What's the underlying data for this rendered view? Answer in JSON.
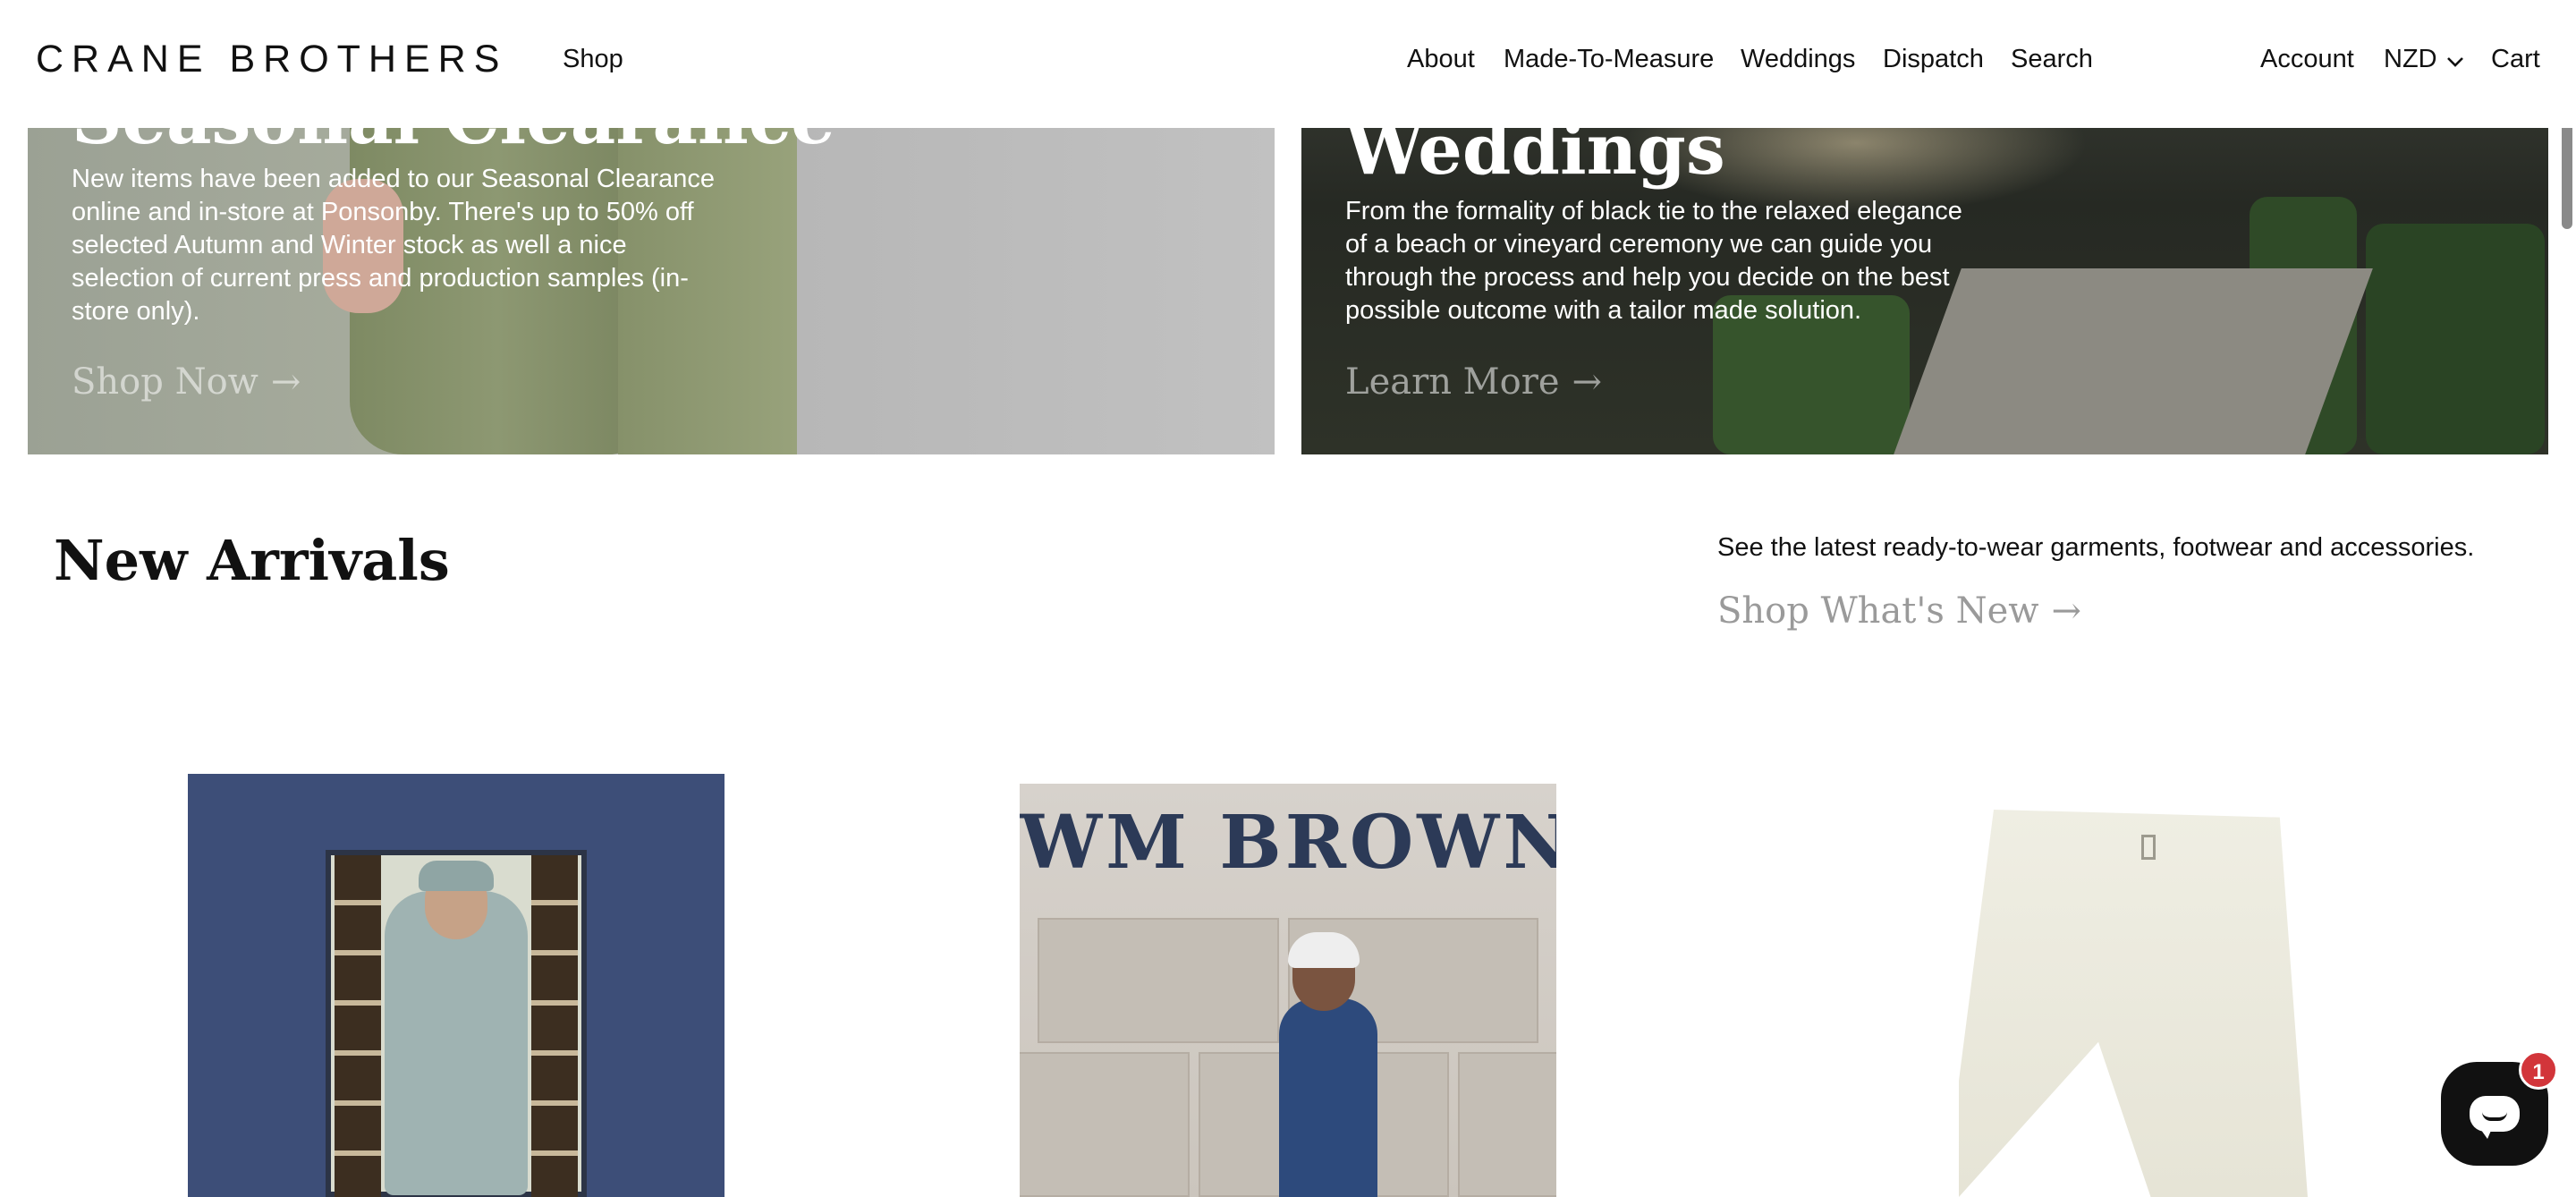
{
  "header": {
    "logo": "CRANE BROTHERS",
    "nav_left": [
      "Shop"
    ],
    "nav_center": [
      "About",
      "Made-To-Measure",
      "Weddings",
      "Dispatch",
      "Search"
    ],
    "account": "Account",
    "currency": "NZD",
    "cart": "Cart"
  },
  "hero": {
    "left": {
      "title": "Seasonal Clearance",
      "body": "New items have been added to our Seasonal Clearance online and in-store at Ponsonby. There's up to 50% off selected Autumn and Winter stock as well a nice selection of current press and production samples (in-store only).",
      "cta": "Shop Now",
      "arrow": "→"
    },
    "right": {
      "title": "Weddings",
      "body": "From the formality of black tie to the relaxed elegance of a beach or vineyard ceremony we can guide you through the process and help you decide on the best possible outcome with a tailor made solution.",
      "cta": "Learn More",
      "arrow": "→"
    }
  },
  "new_arrivals": {
    "title": "New Arrivals",
    "description": "See the latest ready-to-wear garments, footwear and accessories.",
    "cta": "Shop What's New",
    "arrow": "→"
  },
  "products": [
    {
      "image_text": ""
    },
    {
      "image_text": "WM BROWN"
    },
    {
      "image_text": ""
    }
  ],
  "chat": {
    "badge_count": "1",
    "icon": "chat-icon"
  },
  "colors": {
    "text": "#111111",
    "muted_cta": "#9a9a9a",
    "chat_bg": "#111111",
    "badge": "#d2353a",
    "book_blue": "#3d4e78",
    "brand_navy": "#2c3a57"
  }
}
